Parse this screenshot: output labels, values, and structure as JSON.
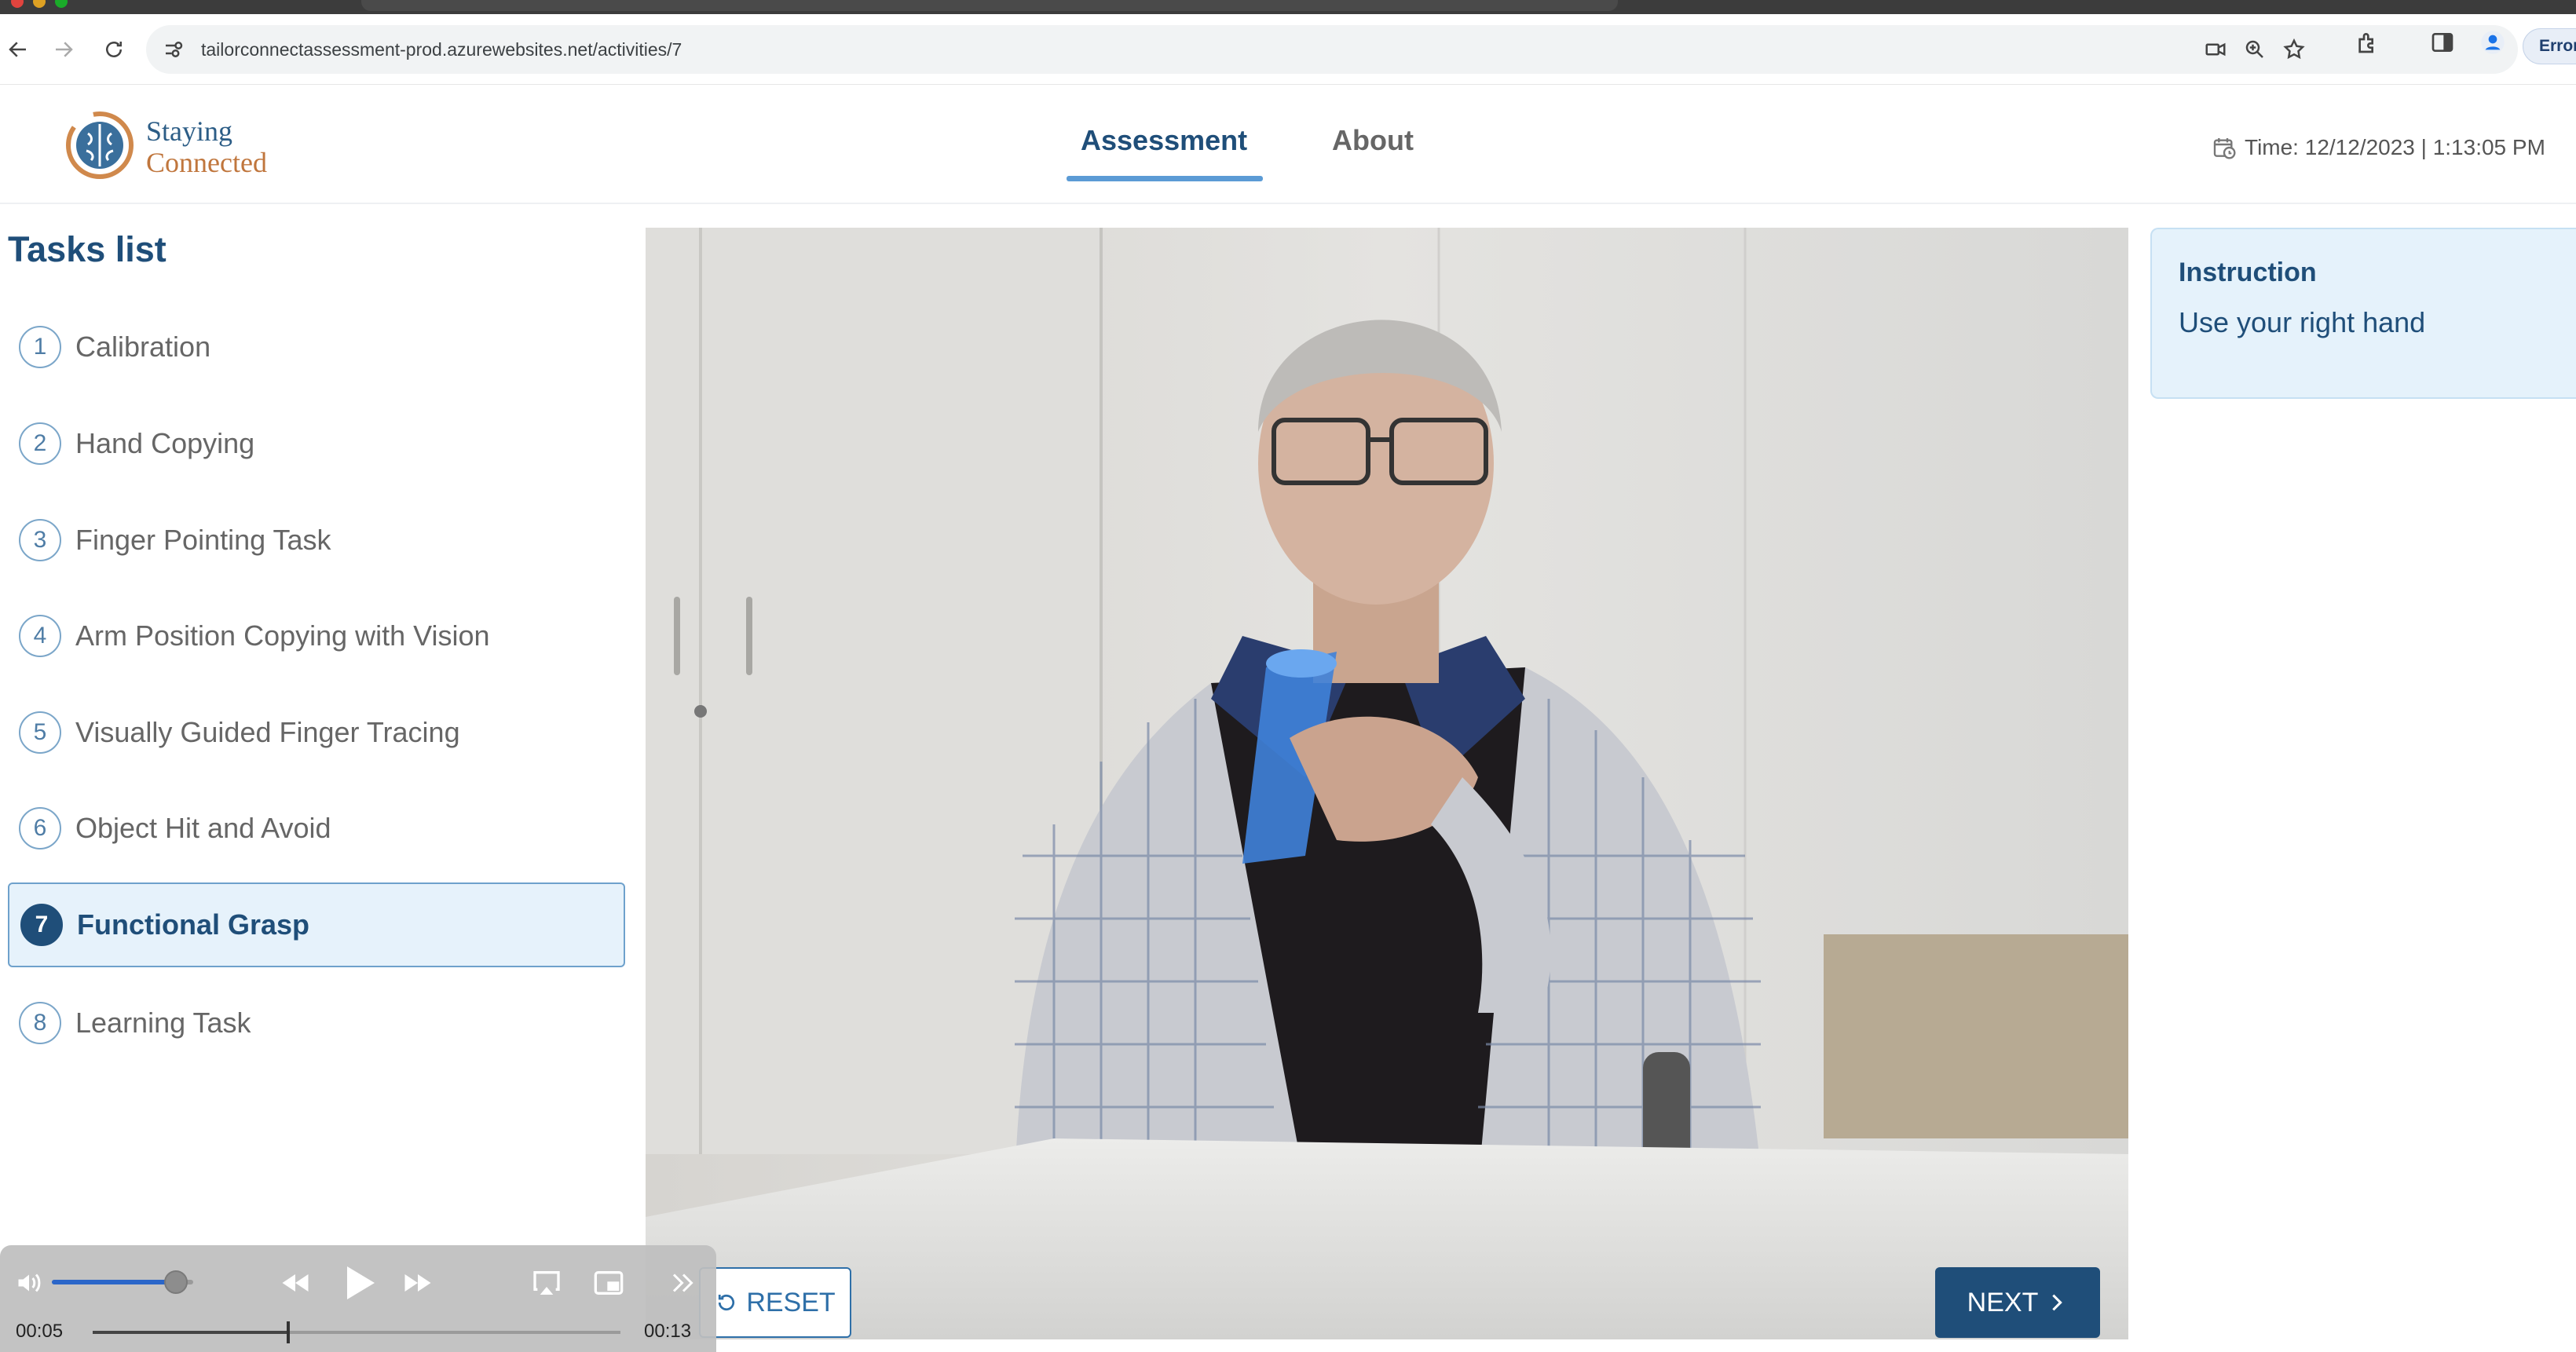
{
  "browser": {
    "url": "tailorconnectassessment-prod.azurewebsites.net/activities/7",
    "profile_chip": "Error"
  },
  "app": {
    "logo_line1": "Staying",
    "logo_line2": "Connected",
    "nav": [
      {
        "label": "Assessment",
        "active": true
      },
      {
        "label": "About",
        "active": false
      }
    ],
    "time_text": "Time: 12/12/2023 | 1:13:05 PM"
  },
  "tasks": {
    "title": "Tasks list",
    "items": [
      {
        "num": "1",
        "label": "Calibration"
      },
      {
        "num": "2",
        "label": "Hand Copying"
      },
      {
        "num": "3",
        "label": "Finger Pointing Task"
      },
      {
        "num": "4",
        "label": "Arm Position Copying with Vision"
      },
      {
        "num": "5",
        "label": "Visually Guided Finger Tracing"
      },
      {
        "num": "6",
        "label": "Object Hit and Avoid"
      },
      {
        "num": "7",
        "label": "Functional Grasp",
        "active": true
      },
      {
        "num": "8",
        "label": "Learning Task"
      }
    ]
  },
  "instruction": {
    "title": "Instruction",
    "text": "Use your right hand"
  },
  "buttons": {
    "reset": "RESET",
    "next": "NEXT"
  },
  "player": {
    "current_time": "00:05",
    "duration": "00:13",
    "progress_fraction": 0.37,
    "volume_fraction": 0.88
  },
  "colors": {
    "primary": "#1f4e79",
    "accent": "#5b9bd5",
    "active_task_bg": "#e6f2fb",
    "instruction_bg": "#e5f2fb"
  }
}
